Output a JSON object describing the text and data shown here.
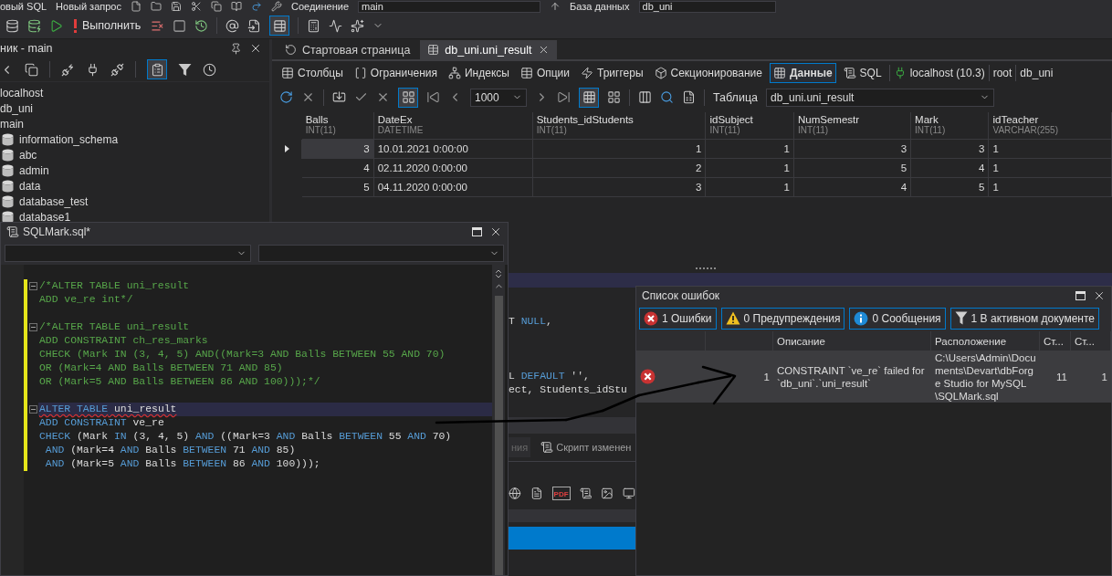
{
  "menu_bar": {
    "items": [
      "овый SQL",
      "Новый запрос"
    ],
    "connection_label": "Соединение",
    "connection": "main",
    "database_label": "База данных",
    "database": "db_uni"
  },
  "toolbar": {
    "execute": "Выполнить",
    "import_pressed": true
  },
  "explorer": {
    "title": "ник - main",
    "view_pressed": true,
    "items": [
      {
        "label": "localhost",
        "kind": "connection"
      },
      {
        "label": "db_uni",
        "kind": "connection"
      },
      {
        "label": "main",
        "kind": "connection"
      },
      {
        "label": "information_schema",
        "kind": "database"
      },
      {
        "label": "abc",
        "kind": "database"
      },
      {
        "label": "admin",
        "kind": "database"
      },
      {
        "label": "data",
        "kind": "database"
      },
      {
        "label": "database_test",
        "kind": "database"
      },
      {
        "label": "database1",
        "kind": "database"
      }
    ]
  },
  "document_tabs": [
    {
      "label": "Стартовая страница",
      "selected": false
    },
    {
      "label": "db_uni.uni_result",
      "selected": true
    }
  ],
  "object_tabs": [
    {
      "label": "Столбцы",
      "kind": "columns",
      "selected": false
    },
    {
      "label": "Ограничения",
      "kind": "constraints",
      "selected": false
    },
    {
      "label": "Индексы",
      "kind": "indexes",
      "selected": false
    },
    {
      "label": "Опции",
      "kind": "options",
      "selected": false
    },
    {
      "label": "Триггеры",
      "kind": "triggers",
      "selected": false
    },
    {
      "label": "Секционирование",
      "kind": "partitions",
      "selected": false
    },
    {
      "label": "Данные",
      "kind": "data",
      "selected": true
    },
    {
      "label": "SQL",
      "kind": "sql",
      "selected": false
    }
  ],
  "connection_info": [
    "localhost (10.3)",
    "root",
    "db_uni"
  ],
  "data_toolbar": {
    "page_size": "1000",
    "table_label": "Таблица",
    "table": "db_uni.uni_result",
    "paging_pressed": true,
    "grid_view_pressed": true
  },
  "grid": {
    "columns": [
      {
        "name": "Balls",
        "type": "INT(11)",
        "kind": "number"
      },
      {
        "name": "DateEx",
        "type": "DATETIME",
        "kind": "text"
      },
      {
        "name": "Students_idStudents",
        "type": "INT(11)",
        "kind": "number"
      },
      {
        "name": "idSubject",
        "type": "INT(11)",
        "kind": "number"
      },
      {
        "name": "NumSemestr",
        "type": "INT(11)",
        "kind": "number"
      },
      {
        "name": "Mark",
        "type": "INT(11)",
        "kind": "number"
      },
      {
        "name": "idTeacher",
        "type": "VARCHAR(255)",
        "kind": "text"
      }
    ],
    "rows": [
      {
        "selected": true,
        "cells": [
          "3",
          "10.01.2021 0:00:00",
          "1",
          "1",
          "3",
          "3",
          "1"
        ]
      },
      {
        "selected": false,
        "cells": [
          "4",
          "02.11.2020 0:00:00",
          "2",
          "1",
          "5",
          "4",
          "1"
        ]
      },
      {
        "selected": false,
        "cells": [
          "5",
          "04.11.2020 0:00:00",
          "3",
          "1",
          "4",
          "5",
          "1"
        ]
      }
    ]
  },
  "background_editor": {
    "lines": [
      {
        "kind": "code",
        "tokens": [
          {
            "text": "T",
            "kind": "plain"
          },
          {
            "text": " NULL",
            "kind": "keyword"
          },
          {
            "text": ",",
            "kind": "plain"
          }
        ]
      },
      {
        "kind": "blank"
      },
      {
        "kind": "blank"
      },
      {
        "kind": "blank"
      },
      {
        "kind": "code",
        "tokens": [
          {
            "text": "L",
            "kind": "plain"
          },
          {
            "text": " DEFAULT",
            "kind": "keyword"
          },
          {
            "text": " '',",
            "kind": "plain"
          }
        ]
      },
      {
        "kind": "code",
        "tokens": [
          {
            "text": "ect, Students_idStu",
            "kind": "plain"
          }
        ]
      }
    ],
    "tabs": [
      {
        "label": "ния",
        "selected": false
      },
      {
        "label": "Скрипт изменен",
        "selected": true
      }
    ],
    "pdf_label": "PDF"
  },
  "sql_window": {
    "title": "SQLMark.sql*",
    "lines": [
      {
        "kind": "code",
        "modified": true,
        "fold": true,
        "current": false,
        "error": false,
        "tokens": [
          {
            "text": "/*ALTER TABLE uni_result",
            "kind": "comment"
          }
        ]
      },
      {
        "kind": "code",
        "modified": true,
        "fold": false,
        "current": false,
        "error": false,
        "tokens": [
          {
            "text": "ADD ve_re int*/",
            "kind": "comment"
          }
        ]
      },
      {
        "kind": "blank",
        "modified": true
      },
      {
        "kind": "code",
        "modified": true,
        "fold": true,
        "current": false,
        "error": false,
        "tokens": [
          {
            "text": "/*ALTER TABLE uni_result",
            "kind": "comment"
          }
        ]
      },
      {
        "kind": "code",
        "modified": true,
        "fold": false,
        "current": false,
        "error": false,
        "tokens": [
          {
            "text": "ADD CONSTRAINT ch_res_marks",
            "kind": "comment"
          }
        ]
      },
      {
        "kind": "code",
        "modified": true,
        "fold": false,
        "current": false,
        "error": false,
        "tokens": [
          {
            "text": "CHECK (Mark IN (3, 4, 5) AND((Mark=3 AND Balls BETWEEN 55 AND 70)",
            "kind": "comment"
          }
        ]
      },
      {
        "kind": "code",
        "modified": true,
        "fold": false,
        "current": false,
        "error": false,
        "tokens": [
          {
            "text": "OR (Mark=4 AND Balls BETWEEN 71 AND 85)",
            "kind": "comment"
          }
        ]
      },
      {
        "kind": "code",
        "modified": true,
        "fold": false,
        "current": false,
        "error": false,
        "tokens": [
          {
            "text": "OR (Mark=5 AND Balls BETWEEN 86 AND 100)));*/",
            "kind": "comment"
          }
        ]
      },
      {
        "kind": "blank",
        "modified": true
      },
      {
        "kind": "code",
        "modified": true,
        "fold": true,
        "current": true,
        "error": true,
        "tokens": [
          {
            "text": "ALTER TABLE",
            "kind": "keyword"
          },
          {
            "text": " uni_result",
            "kind": "plain"
          }
        ]
      },
      {
        "kind": "code",
        "modified": true,
        "fold": false,
        "current": false,
        "error": false,
        "tokens": [
          {
            "text": "ADD CONSTRAINT",
            "kind": "keyword"
          },
          {
            "text": " ve_re",
            "kind": "plain"
          }
        ]
      },
      {
        "kind": "code",
        "modified": true,
        "fold": false,
        "current": false,
        "error": false,
        "tokens": [
          {
            "text": "CHECK",
            "kind": "keyword"
          },
          {
            "text": " (Mark",
            "kind": "plain"
          },
          {
            "text": " IN",
            "kind": "keyword"
          },
          {
            "text": " (3, 4, 5)",
            "kind": "plain"
          },
          {
            "text": " AND",
            "kind": "keyword"
          },
          {
            "text": " ((Mark=3",
            "kind": "plain"
          },
          {
            "text": " AND",
            "kind": "keyword"
          },
          {
            "text": " Balls",
            "kind": "plain"
          },
          {
            "text": " BETWEEN",
            "kind": "keyword"
          },
          {
            "text": " 55",
            "kind": "plain"
          },
          {
            "text": " AND",
            "kind": "keyword"
          },
          {
            "text": " 70)",
            "kind": "plain"
          }
        ]
      },
      {
        "kind": "code",
        "modified": true,
        "fold": false,
        "current": false,
        "error": false,
        "tokens": [
          {
            "text": " AND",
            "kind": "keyword"
          },
          {
            "text": " (Mark=4",
            "kind": "plain"
          },
          {
            "text": " AND",
            "kind": "keyword"
          },
          {
            "text": " Balls",
            "kind": "plain"
          },
          {
            "text": " BETWEEN",
            "kind": "keyword"
          },
          {
            "text": " 71",
            "kind": "plain"
          },
          {
            "text": " AND",
            "kind": "keyword"
          },
          {
            "text": " 85)",
            "kind": "plain"
          }
        ]
      },
      {
        "kind": "code",
        "modified": true,
        "fold": false,
        "current": false,
        "error": false,
        "tokens": [
          {
            "text": " AND",
            "kind": "keyword"
          },
          {
            "text": " (Mark=5",
            "kind": "plain"
          },
          {
            "text": " AND",
            "kind": "keyword"
          },
          {
            "text": " Balls",
            "kind": "plain"
          },
          {
            "text": " BETWEEN",
            "kind": "keyword"
          },
          {
            "text": " 86",
            "kind": "plain"
          },
          {
            "text": " AND",
            "kind": "keyword"
          },
          {
            "text": " 100)));",
            "kind": "plain"
          }
        ]
      }
    ]
  },
  "error_list": {
    "title": "Список ошибок",
    "filters": [
      {
        "label": "1 Ошибки",
        "kind": "error",
        "selected": true
      },
      {
        "label": "0 Предупреждения",
        "kind": "warning",
        "selected": true
      },
      {
        "label": "0 Сообщения",
        "kind": "info",
        "selected": true
      },
      {
        "label": "1 В активном документе",
        "kind": "filter",
        "selected": true
      }
    ],
    "columns": [
      "Описание",
      "Расположение",
      "Ст...",
      "Ст..."
    ],
    "rows": [
      {
        "kind": "error",
        "selected": true,
        "number": "1",
        "description": "CONSTRAINT `ve_re` failed for `db_uni`.`uni_result`",
        "location": "C:\\Users\\Admin\\Documents\\Devart\\dbForge Studio for MySQL\\SQLMark.sql",
        "line": "11",
        "column": "1"
      }
    ]
  }
}
